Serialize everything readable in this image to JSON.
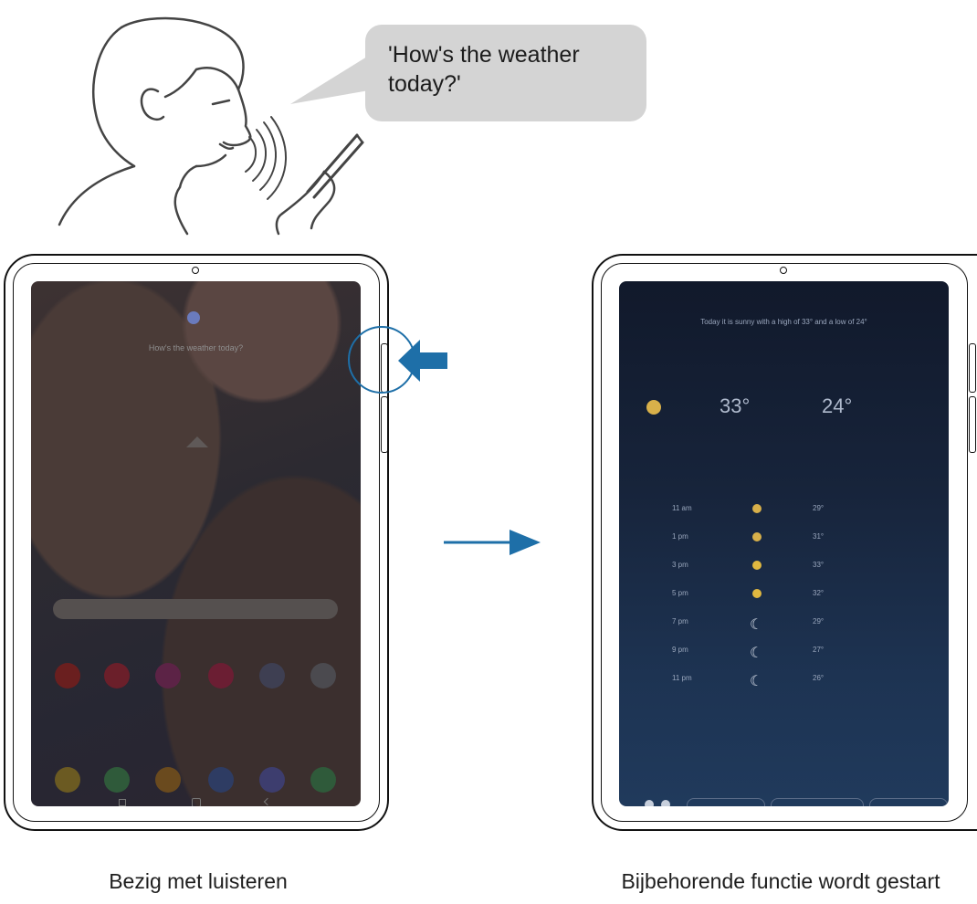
{
  "speech_bubble": {
    "text": "'How's the weather\ntoday?'"
  },
  "left_panel": {
    "caption": "Bezig met luisteren",
    "screen_prompt": "How's the weather today?",
    "app_icon_colors": [
      "#6a1f1f",
      "#6b1f2a",
      "#5c2346",
      "#6b1e33",
      "#3e3f52",
      "#4b4a4f"
    ],
    "dock_icon_colors": [
      "#6b5a22",
      "#2f5a3a",
      "#6a4a1e",
      "#2e3c63",
      "#3d3d6e",
      "#2f5a3a"
    ]
  },
  "right_panel": {
    "caption": "Bijbehorende functie wordt gestart",
    "screen": {
      "summary": "Today it is sunny with a high of 33° and a low of 24°",
      "high": "33°",
      "low": "24°",
      "hourly": [
        {
          "time": "11 am",
          "icon": "sun-cloud-icon",
          "temp": "29°"
        },
        {
          "time": "1 pm",
          "icon": "sun-cloud-icon",
          "temp": "31°"
        },
        {
          "time": "3 pm",
          "icon": "sun-icon",
          "temp": "33°"
        },
        {
          "time": "5 pm",
          "icon": "sun-icon",
          "temp": "32°"
        },
        {
          "time": "7 pm",
          "icon": "moon-icon",
          "temp": "29°"
        },
        {
          "time": "9 pm",
          "icon": "moon-icon",
          "temp": "27°"
        },
        {
          "time": "11 pm",
          "icon": "moon-cloud-icon",
          "temp": "26°"
        }
      ]
    }
  },
  "colors": {
    "arrow": "#1e6fa8",
    "side_key_highlight": "#1e6fa8"
  }
}
